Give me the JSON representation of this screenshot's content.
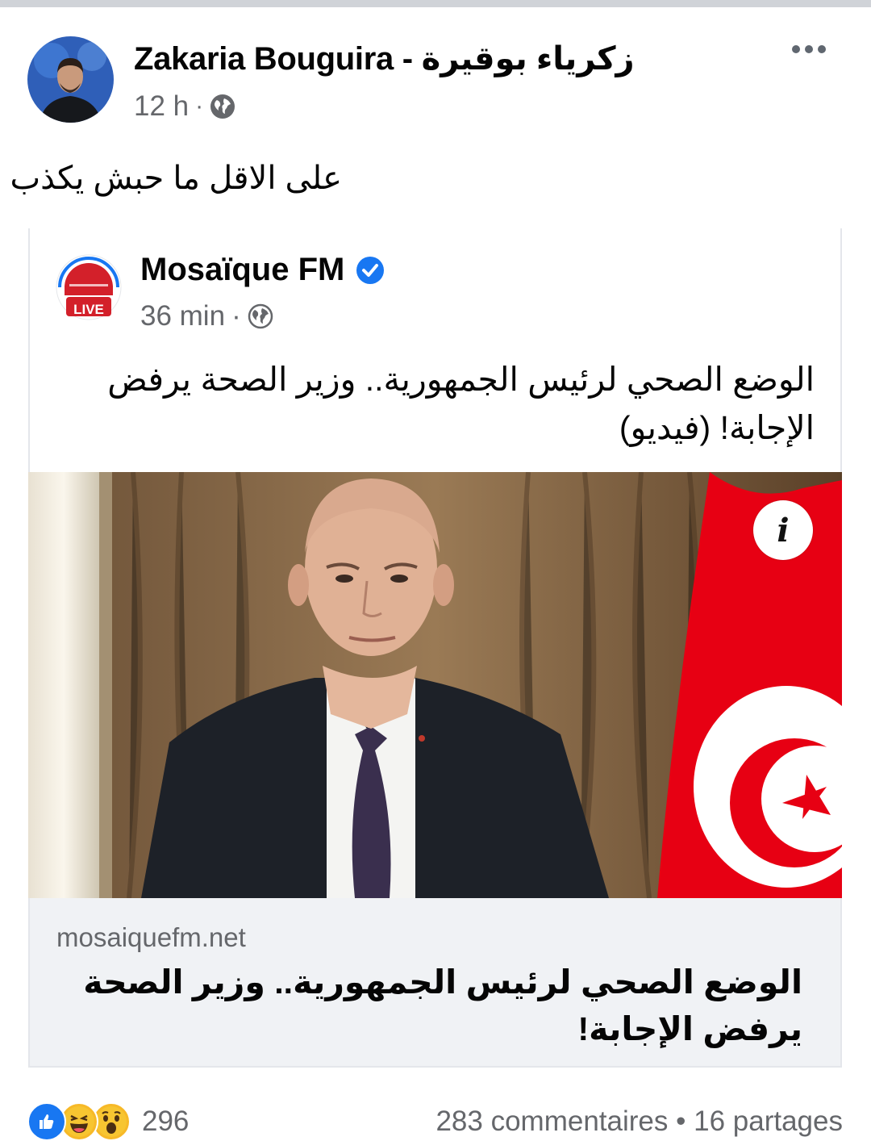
{
  "post": {
    "author": "Zakaria Bouguira - زكرياء بوقيرة",
    "time": "12 h",
    "separator": "·",
    "caption": "على الاقل ما حبش يكذب"
  },
  "shared": {
    "page_name": "Mosaïque FM",
    "logo_badge": "LIVE",
    "time": "36 min",
    "separator": "·",
    "text": "الوضع الصحي لرئيس الجمهورية.. وزير الصحة يرفض الإجابة! (فيديو)",
    "info_label": "i",
    "link": {
      "domain": "mosaiquefm.net",
      "title": "الوضع الصحي لرئيس الجمهورية.. وزير الصحة يرفض الإجابة!"
    }
  },
  "footer": {
    "reaction_count": "296",
    "comments": "283 commentaires",
    "bullet": "•",
    "shares": "16 partages",
    "reactions": [
      "like-icon",
      "haha-icon",
      "wow-icon"
    ]
  },
  "colors": {
    "facebook_blue": "#1877f2",
    "verified": "#1877f2",
    "flag_red": "#e70013",
    "muted": "#65676b"
  }
}
